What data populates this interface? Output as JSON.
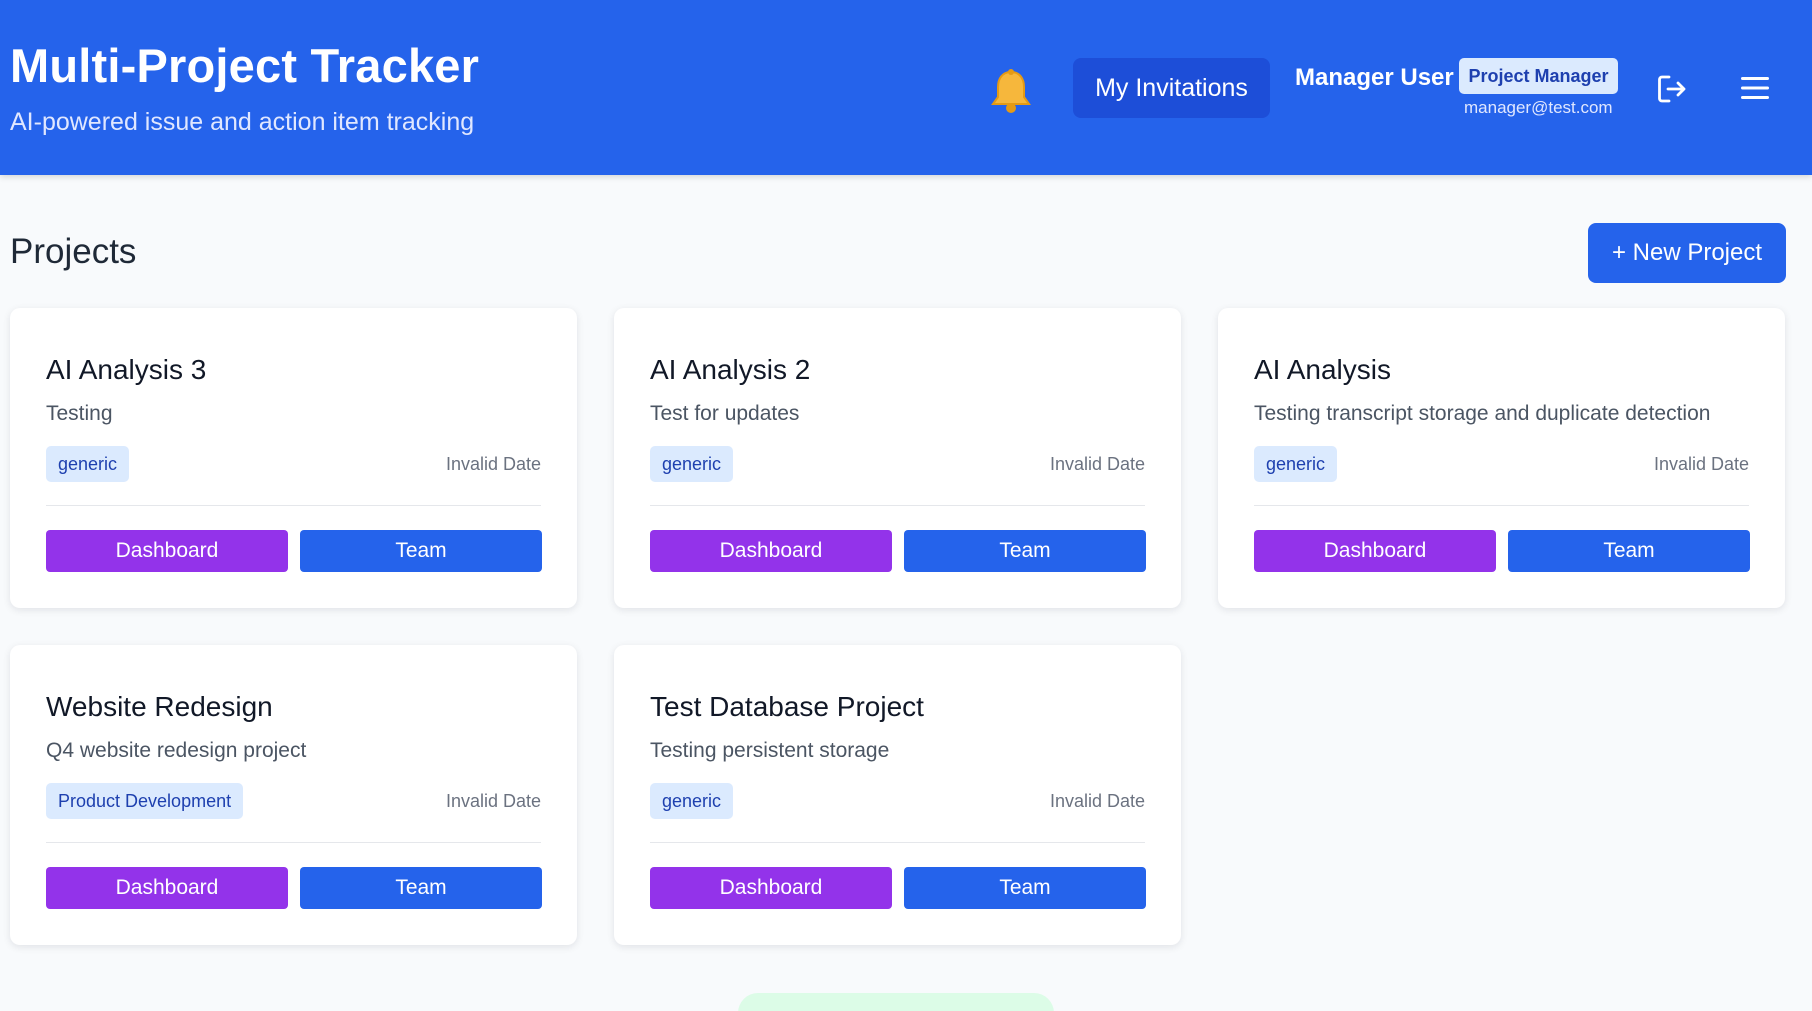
{
  "header": {
    "title": "Multi-Project Tracker",
    "subtitle": "AI-powered issue and action item tracking",
    "invitations_label": "My Invitations",
    "user_name": "Manager User",
    "user_role": "Project Manager",
    "user_email": "manager@test.com",
    "bell_icon": "bell-icon",
    "logout_icon": "logout-icon",
    "menu_icon": "hamburger-menu-icon"
  },
  "main": {
    "section_title": "Projects",
    "new_project_label": "+ New Project"
  },
  "projects": [
    {
      "name": "AI Analysis 3",
      "description": "Testing",
      "tag": "generic",
      "date": "Invalid Date",
      "dashboard_label": "Dashboard",
      "team_label": "Team"
    },
    {
      "name": "AI Analysis 2",
      "description": "Test for updates",
      "tag": "generic",
      "date": "Invalid Date",
      "dashboard_label": "Dashboard",
      "team_label": "Team"
    },
    {
      "name": "AI Analysis",
      "description": "Testing transcript storage and duplicate detection",
      "tag": "generic",
      "date": "Invalid Date",
      "dashboard_label": "Dashboard",
      "team_label": "Team"
    },
    {
      "name": "Website Redesign",
      "description": "Q4 website redesign project",
      "tag": "Product Development",
      "date": "Invalid Date",
      "dashboard_label": "Dashboard",
      "team_label": "Team"
    },
    {
      "name": "Test Database Project",
      "description": "Testing persistent storage",
      "tag": "generic",
      "date": "Invalid Date",
      "dashboard_label": "Dashboard",
      "team_label": "Team"
    }
  ],
  "colors": {
    "brand_blue": "#2563eb",
    "dashboard_purple": "#9333ea",
    "tag_bg": "#dbeafe"
  }
}
